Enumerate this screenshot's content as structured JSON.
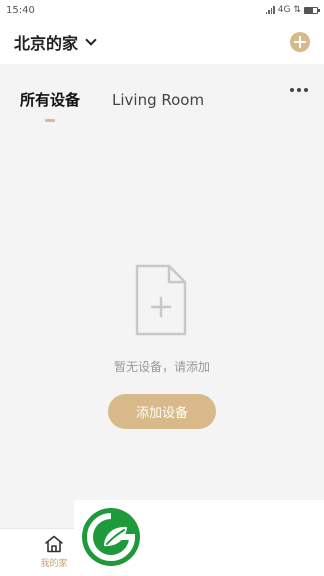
{
  "status_bar": {
    "time": "15:40",
    "network": "4G"
  },
  "header": {
    "home_name": "北京的家"
  },
  "tabs": [
    {
      "label": "所有设备",
      "active": true
    },
    {
      "label": "Living Room",
      "active": false
    }
  ],
  "empty_state": {
    "message": "暂无设备，请添加",
    "button_label": "添加设备"
  },
  "bottom_nav": {
    "home_label": "我的家"
  },
  "colors": {
    "accent": "#d8b98a",
    "logo_green": "#1e9a3a"
  }
}
